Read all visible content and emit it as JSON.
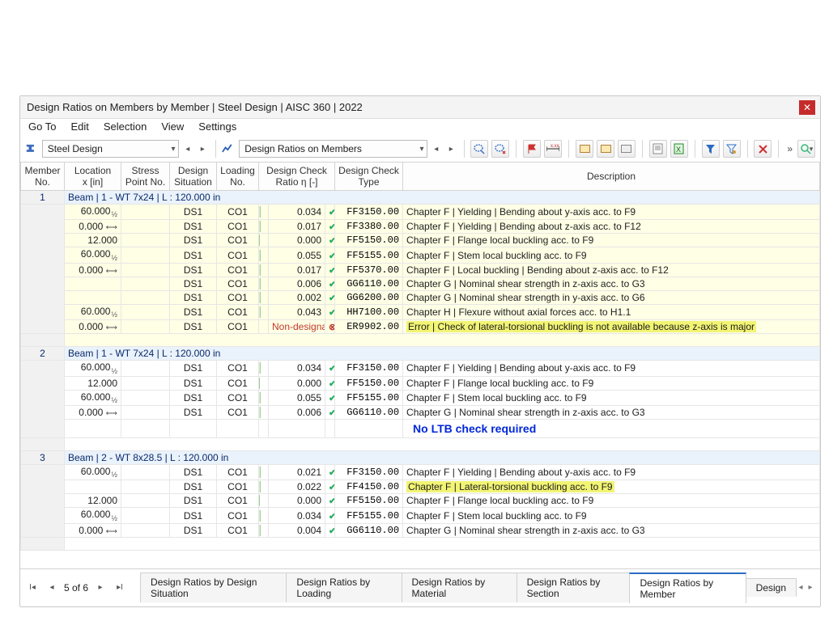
{
  "title": "Design Ratios on Members by Member | Steel Design | AISC 360 | 2022",
  "menu": {
    "go_to": "Go To",
    "edit": "Edit",
    "selection": "Selection",
    "view": "View",
    "settings": "Settings"
  },
  "toolbar": {
    "steel": "Steel Design",
    "mode": "Design Ratios on Members",
    "more": "»"
  },
  "columns": {
    "member": "Member\nNo.",
    "loc": "Location\nx [in]",
    "sp": "Stress\nPoint No.",
    "ds": "Design\nSituation",
    "ld": "Loading\nNo.",
    "ratio": "Design Check\nRatio η [-]",
    "type": "Design Check\nType",
    "desc": "Description"
  },
  "groups": [
    {
      "member": "1",
      "label": "Beam | 1 - WT 7x24 | L : 120.000 in",
      "style": "data",
      "rows": [
        {
          "loc": "60.000",
          "half": true,
          "ds": "DS1",
          "ld": "CO1",
          "ratio": "0.034",
          "code": "FF3150.00",
          "desc": "Chapter F | Yielding | Bending about y-axis acc. to F9"
        },
        {
          "loc": "0.000",
          "lock": true,
          "ds": "DS1",
          "ld": "CO1",
          "ratio": "0.017",
          "code": "FF3380.00",
          "desc": "Chapter F | Yielding | Bending about z-axis acc. to F12"
        },
        {
          "loc": "12.000",
          "ds": "DS1",
          "ld": "CO1",
          "ratio": "0.000",
          "code": "FF5150.00",
          "desc": "Chapter F | Flange local buckling acc. to F9"
        },
        {
          "loc": "60.000",
          "half": true,
          "ds": "DS1",
          "ld": "CO1",
          "ratio": "0.055",
          "code": "FF5155.00",
          "desc": "Chapter F | Stem local buckling acc. to F9"
        },
        {
          "loc": "0.000",
          "lock": true,
          "ds": "DS1",
          "ld": "CO1",
          "ratio": "0.017",
          "code": "FF5370.00",
          "desc": "Chapter F | Local buckling | Bending about z-axis acc. to F12"
        },
        {
          "loc": "",
          "ds": "DS1",
          "ld": "CO1",
          "ratio": "0.006",
          "code": "GG6110.00",
          "desc": "Chapter G | Nominal shear strength in z-axis acc. to G3"
        },
        {
          "loc": "",
          "ds": "DS1",
          "ld": "CO1",
          "ratio": "0.002",
          "code": "GG6200.00",
          "desc": "Chapter G | Nominal shear strength in y-axis acc. to G6"
        },
        {
          "loc": "60.000",
          "half": true,
          "ds": "DS1",
          "ld": "CO1",
          "ratio": "0.043",
          "code": "HH7100.00",
          "desc": "Chapter H | Flexure without axial forces acc. to H1.1"
        },
        {
          "loc": "0.000",
          "lock": true,
          "ds": "DS1",
          "ld": "CO1",
          "ratio": "Non-designable",
          "nondesignable": true,
          "code": "ER9902.00",
          "desc": "Error | Check of lateral-torsional buckling is not available because z-axis is major",
          "err": true
        }
      ]
    },
    {
      "member": "2",
      "label": "Beam | 1 - WT 7x24 | L : 120.000 in",
      "style": "data2",
      "rows": [
        {
          "loc": "60.000",
          "half": true,
          "ds": "DS1",
          "ld": "CO1",
          "ratio": "0.034",
          "code": "FF3150.00",
          "desc": "Chapter F | Yielding | Bending about y-axis acc. to F9"
        },
        {
          "loc": "12.000",
          "ds": "DS1",
          "ld": "CO1",
          "ratio": "0.000",
          "code": "FF5150.00",
          "desc": "Chapter F | Flange local buckling acc. to F9"
        },
        {
          "loc": "60.000",
          "half": true,
          "ds": "DS1",
          "ld": "CO1",
          "ratio": "0.055",
          "code": "FF5155.00",
          "desc": "Chapter F | Stem local buckling acc. to F9"
        },
        {
          "loc": "0.000",
          "lock": true,
          "ds": "DS1",
          "ld": "CO1",
          "ratio": "0.006",
          "code": "GG6110.00",
          "desc": "Chapter G | Nominal shear strength in z-axis acc. to G3"
        }
      ],
      "note": "No LTB check required"
    },
    {
      "member": "3",
      "label": "Beam | 2 - WT 8x28.5 | L : 120.000 in",
      "style": "data2",
      "rows": [
        {
          "loc": "60.000",
          "half": true,
          "ds": "DS1",
          "ld": "CO1",
          "ratio": "0.021",
          "code": "FF3150.00",
          "desc": "Chapter F | Yielding | Bending about y-axis acc. to F9"
        },
        {
          "loc": "",
          "ds": "DS1",
          "ld": "CO1",
          "ratio": "0.022",
          "code": "FF4150.00",
          "desc": "Chapter F | Lateral-torsional buckling acc. to F9",
          "ltb": true
        },
        {
          "loc": "12.000",
          "ds": "DS1",
          "ld": "CO1",
          "ratio": "0.000",
          "code": "FF5150.00",
          "desc": "Chapter F | Flange local buckling acc. to F9"
        },
        {
          "loc": "60.000",
          "half": true,
          "ds": "DS1",
          "ld": "CO1",
          "ratio": "0.034",
          "code": "FF5155.00",
          "desc": "Chapter F | Stem local buckling acc. to F9"
        },
        {
          "loc": "0.000",
          "lock": true,
          "ds": "DS1",
          "ld": "CO1",
          "ratio": "0.004",
          "code": "GG6110.00",
          "desc": "Chapter G | Nominal shear strength in z-axis acc. to G3"
        }
      ]
    }
  ],
  "pager": {
    "text": "5 of 6"
  },
  "tabs": [
    "Design Ratios by Design Situation",
    "Design Ratios by Loading",
    "Design Ratios by Material",
    "Design Ratios by Section",
    "Design Ratios by Member",
    "Design"
  ],
  "active_tab": 4
}
